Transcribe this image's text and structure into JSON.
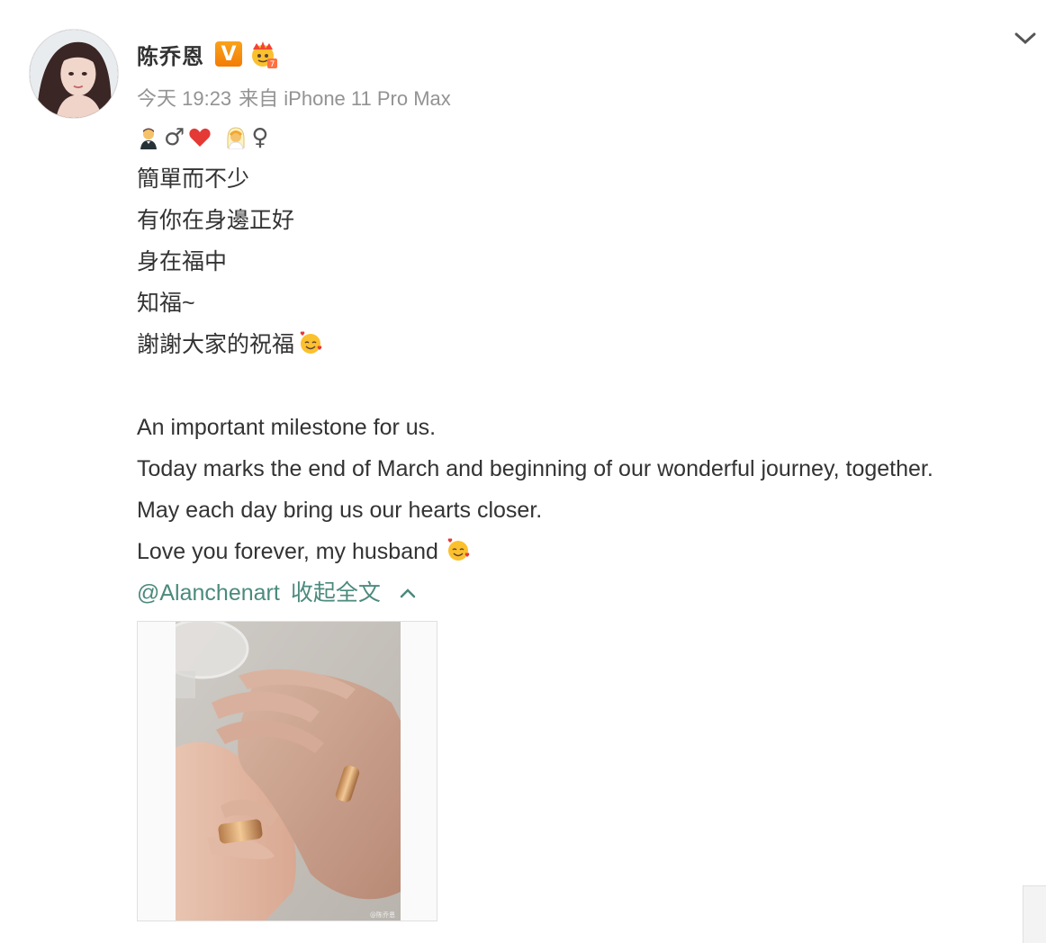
{
  "post": {
    "author": "陈乔恩",
    "badge_v": "V",
    "badge_member_icon": "crown-member-icon",
    "timestamp": "今天 19:23",
    "source": "来自 iPhone 11 Pro Max",
    "body_lines": [
      "簡單而不少",
      "有你在身邊正好",
      "身在福中",
      "知福~",
      "謝謝大家的祝福"
    ],
    "english_lines": [
      "An important milestone for us.",
      "Today marks the end of March and beginning of our wonderful journey, together.",
      "May each day bring us our hearts closer.",
      "Love you forever, my husband"
    ],
    "emoji_symbols": {
      "male": "♂",
      "female": "♀"
    },
    "mention": "@Alanchenart",
    "collapse_label": "收起全文",
    "photo_watermark": "@陈乔恩"
  },
  "colors": {
    "link": "#4b8a7d",
    "meta": "#939393",
    "text": "#333333",
    "badge": "#f37c06"
  }
}
